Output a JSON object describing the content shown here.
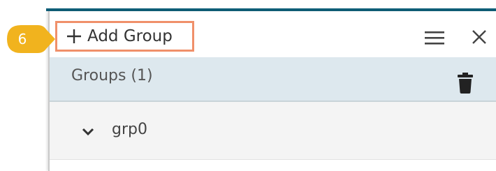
{
  "toolbar": {
    "add_group_label": "Add Group"
  },
  "groups": {
    "title": "Groups (1)",
    "items": [
      {
        "name": "grp0"
      }
    ]
  },
  "annotation": {
    "step_number": "6"
  },
  "colors": {
    "accent": "#0f5e78",
    "highlight_border": "#f0906a",
    "badge": "#f1b31e",
    "groups_header_bg": "#dde8ee"
  },
  "icons": [
    "plus-icon",
    "hamburger-menu-icon",
    "close-icon",
    "trash-icon",
    "chevron-down-icon"
  ]
}
